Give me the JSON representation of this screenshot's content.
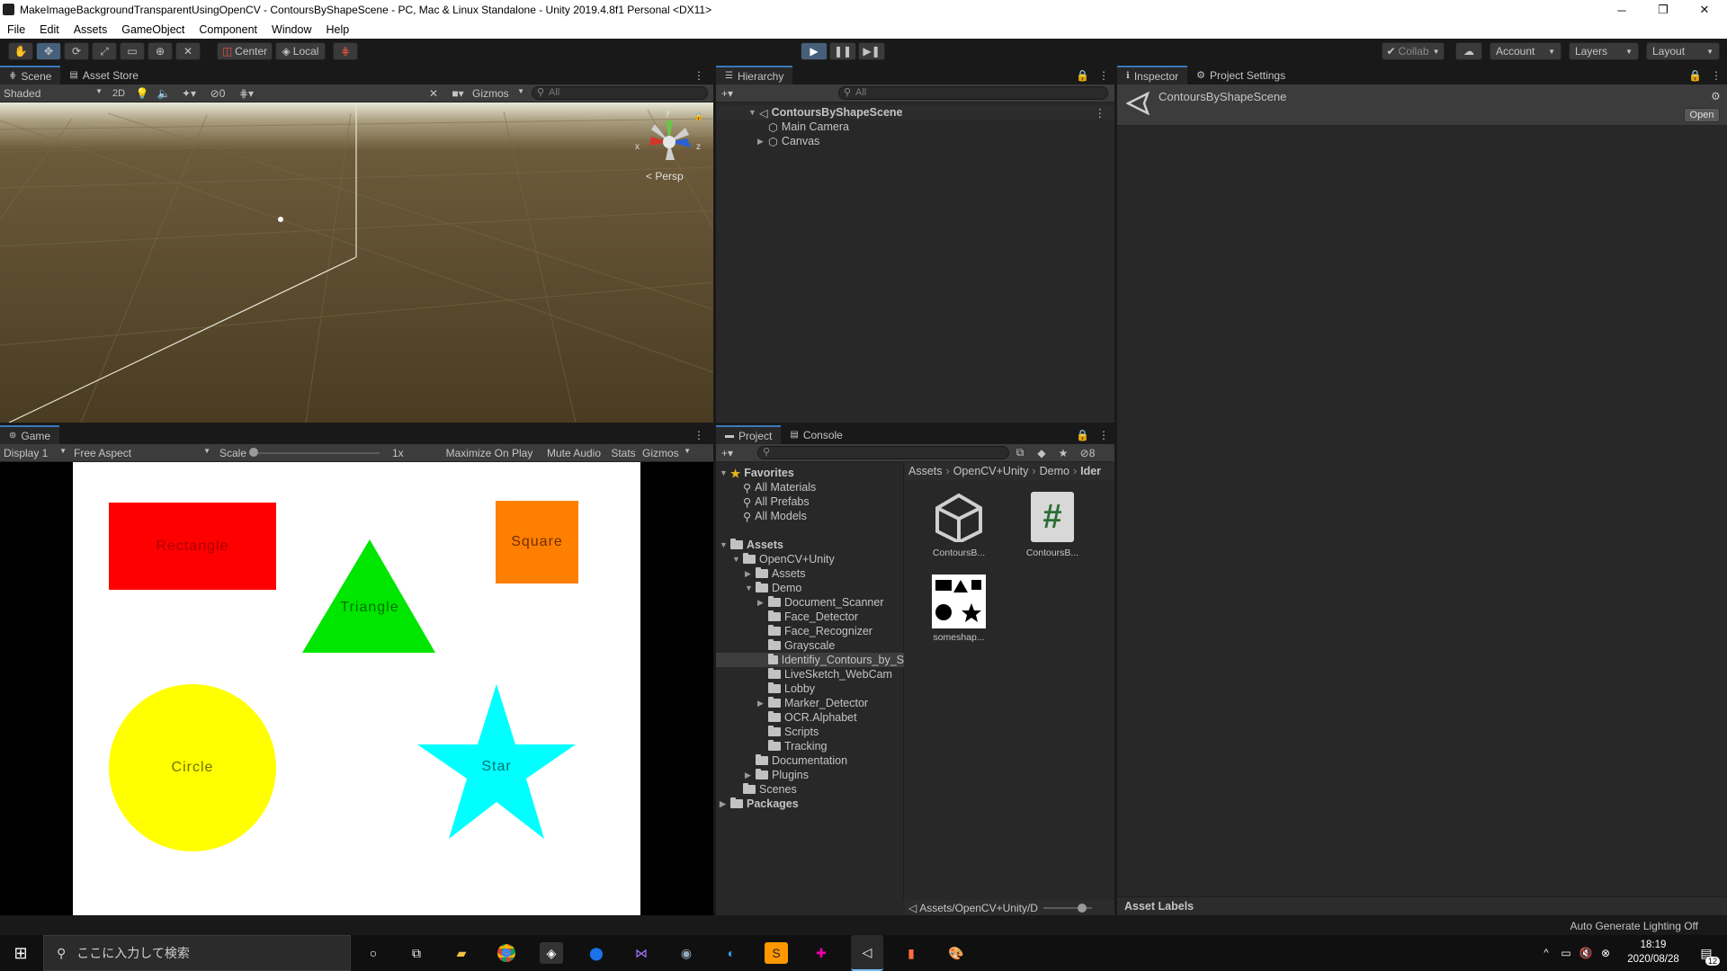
{
  "window": {
    "title": "MakeImageBackgroundTransparentUsingOpenCV - ContoursByShapeScene - PC, Mac & Linux Standalone - Unity 2019.4.8f1 Personal <DX11>",
    "minimize": "─",
    "maximize": "❐",
    "close": "✕"
  },
  "menu": [
    "File",
    "Edit",
    "Assets",
    "GameObject",
    "Component",
    "Window",
    "Help"
  ],
  "toolbar": {
    "pivot": "Center",
    "space": "Local",
    "collab": "Collab",
    "account": "Account",
    "layers": "Layers",
    "layout": "Layout"
  },
  "scene": {
    "tab_scene": "Scene",
    "tab_store": "Asset Store",
    "shading": "Shaded",
    "mode_2d": "2D",
    "fx_count": "0",
    "gizmos": "Gizmos",
    "search_placeholder": "All",
    "persp": "Persp",
    "axis_x": "x",
    "axis_y": "y",
    "axis_z": "z"
  },
  "game": {
    "tab": "Game",
    "display": "Display 1",
    "aspect": "Free Aspect",
    "scale_label": "Scale",
    "scale_value": "1x",
    "maximize": "Maximize On Play",
    "mute": "Mute Audio",
    "stats": "Stats",
    "gizmos": "Gizmos",
    "shapes": {
      "rectangle": "Rectangle",
      "square": "Square",
      "triangle": "Triangle",
      "circle": "Circle",
      "star": "Star"
    },
    "colors": {
      "rectangle": "#ff0000",
      "square": "#ff7f00",
      "triangle": "#00e600",
      "circle": "#ffff00",
      "star": "#00ffff"
    }
  },
  "hierarchy": {
    "tab": "Hierarchy",
    "search_placeholder": "All",
    "scene": "ContoursByShapeScene",
    "items": [
      "Main Camera",
      "Canvas"
    ]
  },
  "inspector": {
    "tab": "Inspector",
    "tab2": "Project Settings",
    "object_name": "ContoursByShapeScene",
    "open_button": "Open",
    "asset_labels": "Asset Labels"
  },
  "project": {
    "tab": "Project",
    "tab2": "Console",
    "hidden_count": "8",
    "favorites": "Favorites",
    "fav_items": [
      "All Materials",
      "All Prefabs",
      "All Models"
    ],
    "assets_root": "Assets",
    "opencv": "OpenCV+Unity",
    "assets_sub": "Assets",
    "demo": "Demo",
    "demo_items": [
      "Document_Scanner",
      "Face_Detector",
      "Face_Recognizer",
      "Grayscale",
      "Identifiy_Contours_by_S",
      "LiveSketch_WebCam",
      "Lobby",
      "Marker_Detector",
      "OCR.Alphabet",
      "Scripts",
      "Tracking"
    ],
    "documentation": "Documentation",
    "plugins": "Plugins",
    "scenes": "Scenes",
    "packages": "Packages",
    "breadcrumb": [
      "Assets",
      "OpenCV+Unity",
      "Demo",
      "Ider"
    ],
    "files": [
      "ContoursB...",
      "ContoursB...",
      "someshap..."
    ],
    "script_glyph": "#",
    "status_path": "Assets/OpenCV+Unity/D"
  },
  "statusbar": {
    "right": "Auto Generate Lighting Off"
  },
  "taskbar": {
    "search_placeholder": "ここに入力して検索",
    "time": "18:19",
    "date": "2020/08/28",
    "notifications": "12"
  }
}
